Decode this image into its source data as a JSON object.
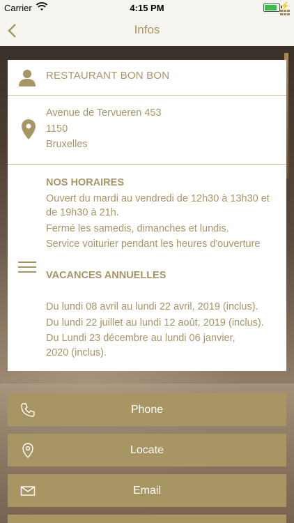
{
  "status_bar": {
    "carrier": "Carrier",
    "time": "4:15 PM"
  },
  "nav": {
    "title": "Infos"
  },
  "info": {
    "name": "RESTAURANT BON BON",
    "address": {
      "street": "Avenue de Tervueren 453",
      "postcode": "1150",
      "city": "Bruxelles"
    },
    "hours_title": "NOS HORAIRES",
    "hours_lines": [
      "Ouvert du mardi au vendredi  de 12h30 à 13h30 et",
      "de 19h30 à 21h.",
      "Fermé les samedis, dimanches et lundis.",
      "Service voiturier pendant les heures d'ouverture"
    ],
    "vacation_title": "VACANCES ANNUELLES",
    "vacation_lines": [
      "Du lundi 08 avril au lundi 22 avril, 2019 (inclus).",
      "Du lundi 22 juillet au lundi 12 août, 2019 (inclus).",
      "Du Lundi 23 décembre au lundi 06 janvier,",
      "2020 (inclus)."
    ]
  },
  "actions": {
    "phone": "Phone",
    "locate": "Locate",
    "email": "Email"
  },
  "colors": {
    "accent": "#a89564",
    "text": "#a89566",
    "nav_bg": "#f6f4ee"
  },
  "icons": [
    "back-chevron-icon",
    "person-icon",
    "location-pin-icon",
    "menu-lines-icon",
    "phone-icon",
    "pin-outline-icon",
    "mail-icon"
  ]
}
